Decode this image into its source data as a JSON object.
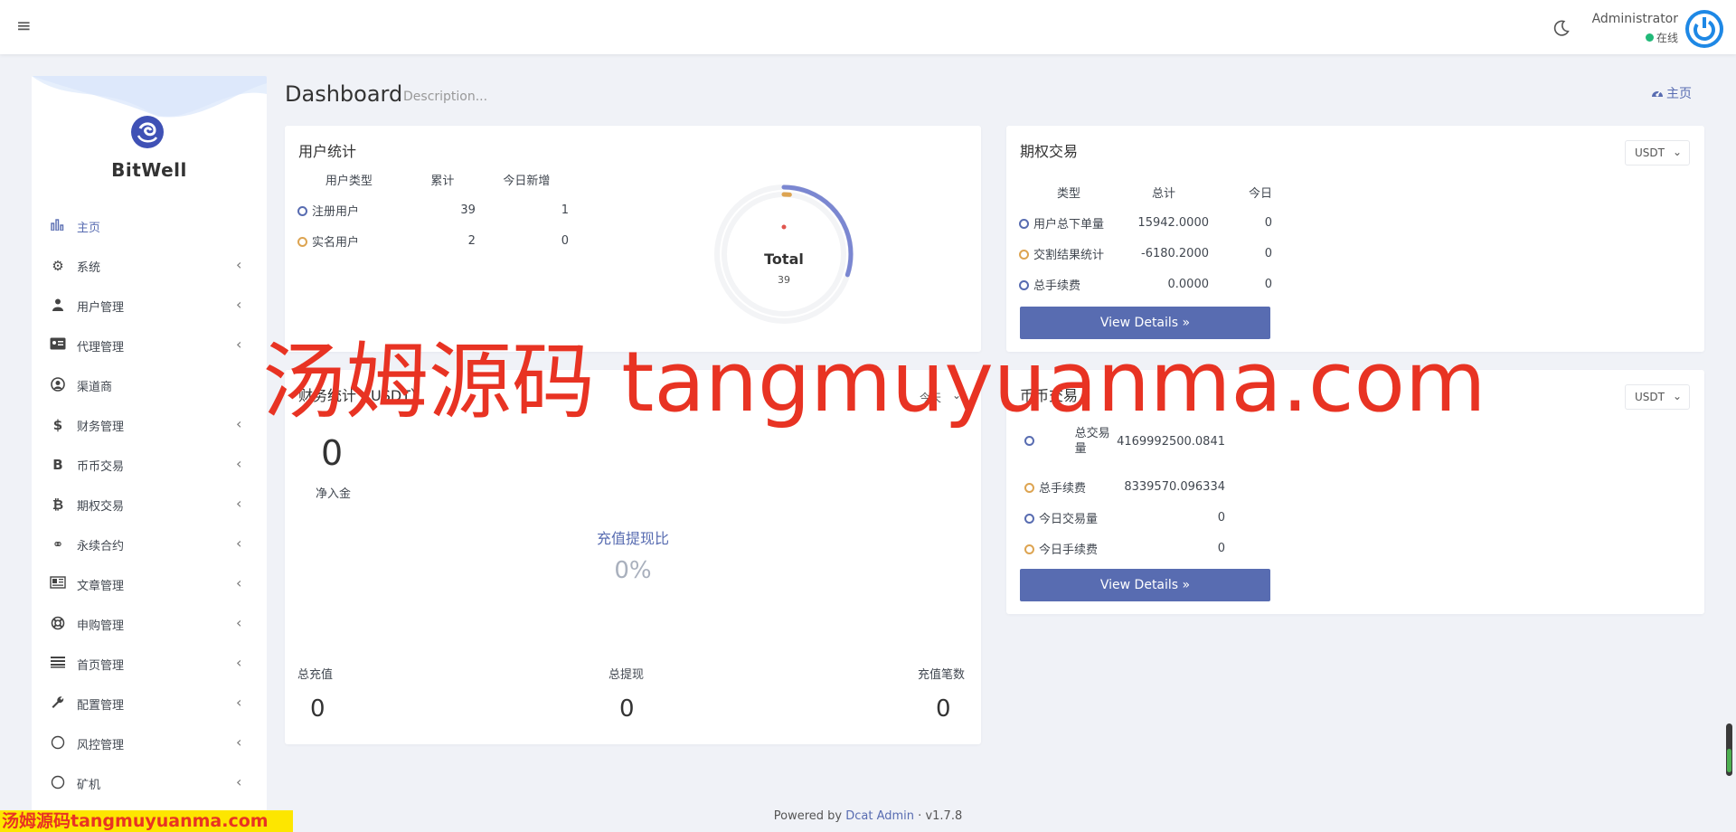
{
  "navbar": {
    "user_name": "Administrator",
    "user_status": "在线",
    "colors": {
      "status": "#21b978",
      "avatar": "#1e88e5"
    }
  },
  "sidebar": {
    "logo_text": "BitWell",
    "items": [
      {
        "label": "主页",
        "icon": "bar-chart-icon",
        "glyph": "",
        "active": true,
        "has_children": false
      },
      {
        "label": "系统",
        "icon": "gear-icon",
        "glyph": "⚙",
        "active": false,
        "has_children": true
      },
      {
        "label": "用户管理",
        "icon": "users-icon",
        "glyph": "",
        "active": false,
        "has_children": true
      },
      {
        "label": "代理管理",
        "icon": "id-card-icon",
        "glyph": "",
        "active": false,
        "has_children": true
      },
      {
        "label": "渠道商",
        "icon": "user-circle-icon",
        "glyph": "",
        "active": false,
        "has_children": false
      },
      {
        "label": "财务管理",
        "icon": "dollar-icon",
        "glyph": "$",
        "active": false,
        "has_children": true
      },
      {
        "label": "币币交易",
        "icon": "bitcoin-icon",
        "glyph": "B",
        "active": false,
        "has_children": true
      },
      {
        "label": "期权交易",
        "icon": "bitcoin-small-icon",
        "glyph": "₿",
        "active": false,
        "has_children": true
      },
      {
        "label": "永续合约",
        "icon": "link-icon",
        "glyph": "⚭",
        "active": false,
        "has_children": true
      },
      {
        "label": "文章管理",
        "icon": "newspaper-icon",
        "glyph": "",
        "active": false,
        "has_children": true
      },
      {
        "label": "申购管理",
        "icon": "life-ring-icon",
        "glyph": "",
        "active": false,
        "has_children": true
      },
      {
        "label": "首页管理",
        "icon": "list-icon",
        "glyph": "",
        "active": false,
        "has_children": true
      },
      {
        "label": "配置管理",
        "icon": "wrench-icon",
        "glyph": "",
        "active": false,
        "has_children": true
      },
      {
        "label": "风控管理",
        "icon": "circle-icon",
        "glyph": "",
        "active": false,
        "has_children": true
      },
      {
        "label": "矿机",
        "icon": "circle-icon",
        "glyph": "",
        "active": false,
        "has_children": true
      }
    ]
  },
  "header": {
    "title": "Dashboard",
    "description": "Description...",
    "breadcrumb": "主页"
  },
  "user_stats": {
    "title": "用户统计",
    "columns": [
      "用户类型",
      "累计",
      "今日新增"
    ],
    "rows": [
      {
        "label": "注册用户",
        "total": "39",
        "today": "1"
      },
      {
        "label": "实名用户",
        "total": "2",
        "today": "0"
      }
    ],
    "donut": {
      "label": "Total",
      "value": "39",
      "registered": 39,
      "verified": 2
    }
  },
  "options_trade": {
    "title": "期权交易",
    "currency": "USDT",
    "columns": [
      "类型",
      "总计",
      "今日"
    ],
    "rows": [
      {
        "label": "用户总下单量",
        "total": "15942.0000",
        "today": "0"
      },
      {
        "label": "交割结果统计",
        "total": "-6180.2000",
        "today": "0"
      },
      {
        "label": "总手续费",
        "total": "0.0000",
        "today": "0"
      }
    ],
    "button": "View Details"
  },
  "finance": {
    "title": "财务统计（USDT）",
    "period": "今天",
    "net_value": "0",
    "net_label": "净入金",
    "ratio_label": "充值提现比",
    "ratio_value": "0%",
    "totals": [
      {
        "label": "总充值",
        "value": "0"
      },
      {
        "label": "总提现",
        "value": "0"
      },
      {
        "label": "充值笔数",
        "value": "0"
      }
    ]
  },
  "spot_trade": {
    "title": "币币交易",
    "currency": "USDT",
    "rows": [
      {
        "label": "总交易量",
        "value": "4169992500.0841"
      },
      {
        "label": "总手续费",
        "value": "8339570.096334"
      },
      {
        "label": "今日交易量",
        "value": "0"
      },
      {
        "label": "今日手续费",
        "value": "0"
      }
    ],
    "button": "View Details"
  },
  "footer": {
    "prefix": "Powered by",
    "link": "Dcat Admin",
    "version": "v1.7.8"
  },
  "watermark": {
    "main": "汤姆源码 tangmuyuanma.com",
    "strip": "汤姆源码tangmuyuanma.com"
  },
  "colors": {
    "primary": "#586cb1",
    "orange": "#dda451",
    "bg": "#f0f2f7"
  }
}
